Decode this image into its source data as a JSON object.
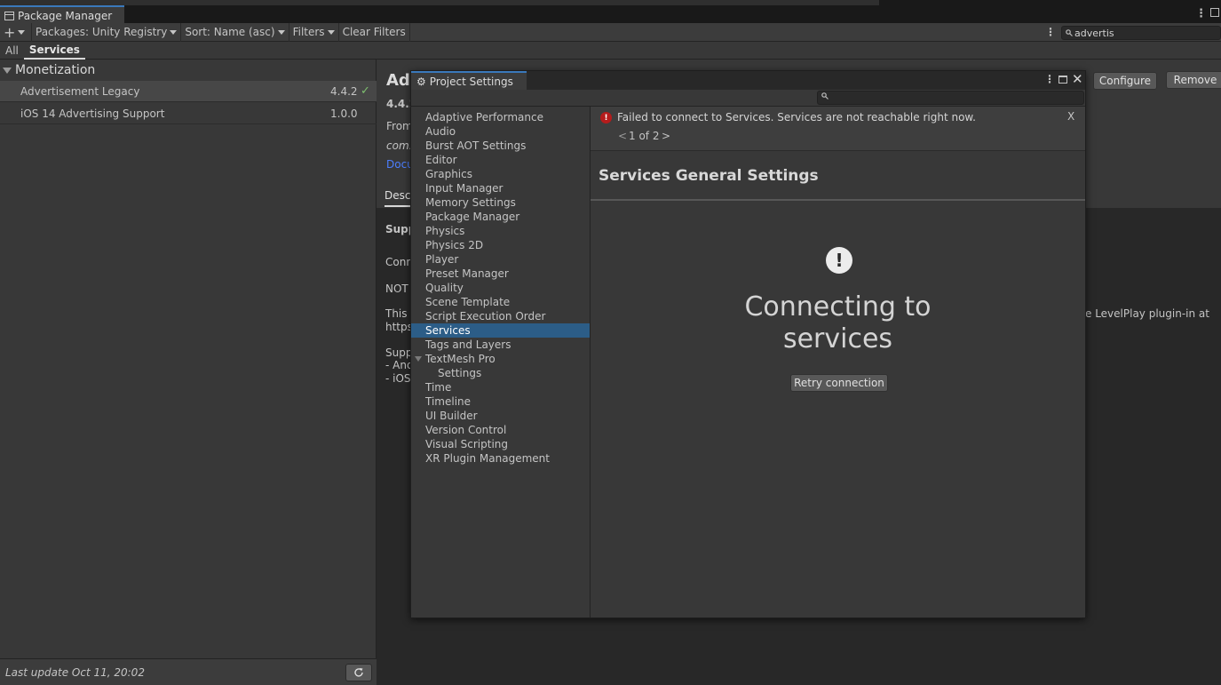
{
  "package_manager": {
    "window_title": "Package Manager",
    "toolbar": {
      "add_label": "+",
      "packages_dropdown": "Packages: Unity Registry",
      "sort_dropdown": "Sort: Name (asc)",
      "filters_dropdown": "Filters",
      "clear_filters": "Clear Filters",
      "search_value": "advertis"
    },
    "tabs": [
      {
        "label": "All",
        "active": false
      },
      {
        "label": "Services",
        "active": true
      }
    ],
    "group": "Monetization",
    "packages": [
      {
        "name": "Advertisement Legacy",
        "version": "4.4.2",
        "installed": true,
        "selected": true
      },
      {
        "name": "iOS 14 Advertising Support",
        "version": "1.0.0",
        "installed": false,
        "selected": false
      }
    ],
    "footer": {
      "last_update": "Last update Oct 11, 20:02"
    },
    "detail": {
      "title_partial": "Ad",
      "version_partial": "4.4.2",
      "from_partial": "From",
      "com_partial": "com.",
      "docs_partial": "Docu",
      "desc_tab_partial": "Desc",
      "supp_bold_partial": "Supp",
      "conn_partial": "Conn",
      "note_partial": "NOT",
      "this_partial": "This",
      "https_partial": "https",
      "right_text": "e LevelPlay plugin-in at",
      "supp2_partial": "Supp",
      "and_partial": "- And",
      "ios_partial": "- iOS",
      "configure_button": "Configure",
      "remove_button": "Remove"
    }
  },
  "project_settings": {
    "window_title": "Project Settings",
    "search_placeholder": "",
    "nav": [
      {
        "label": "Adaptive Performance"
      },
      {
        "label": "Audio"
      },
      {
        "label": "Burst AOT Settings"
      },
      {
        "label": "Editor"
      },
      {
        "label": "Graphics"
      },
      {
        "label": "Input Manager"
      },
      {
        "label": "Memory Settings"
      },
      {
        "label": "Package Manager"
      },
      {
        "label": "Physics"
      },
      {
        "label": "Physics 2D"
      },
      {
        "label": "Player"
      },
      {
        "label": "Preset Manager"
      },
      {
        "label": "Quality"
      },
      {
        "label": "Scene Template"
      },
      {
        "label": "Script Execution Order"
      },
      {
        "label": "Services",
        "selected": true
      },
      {
        "label": "Tags and Layers"
      },
      {
        "label": "TextMesh Pro",
        "expanded": true
      },
      {
        "label": "Settings",
        "child": true
      },
      {
        "label": "Time"
      },
      {
        "label": "Timeline"
      },
      {
        "label": "UI Builder"
      },
      {
        "label": "Version Control"
      },
      {
        "label": "Visual Scripting"
      },
      {
        "label": "XR Plugin Management"
      }
    ],
    "alert": {
      "message": "Failed to connect to Services. Services are not reachable right now.",
      "pager": "1 of 2",
      "prev": "<",
      "next": ">",
      "close": "X"
    },
    "section_title": "Services General Settings",
    "status_line1": "Connecting to",
    "status_line2": "services",
    "retry_button": "Retry connection"
  },
  "colors": {
    "selection": "#2c5d87",
    "error": "#b51c1c",
    "link": "#4c7eff",
    "installed_check": "#7dbf6e"
  }
}
